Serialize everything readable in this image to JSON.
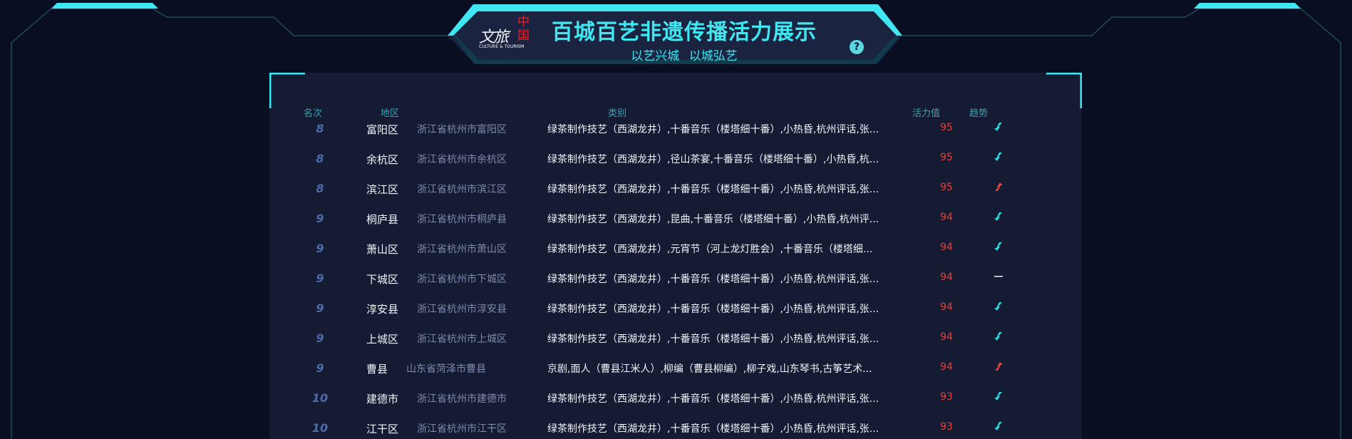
{
  "header": {
    "title": "百城百艺非遗传播活力展示",
    "subtitle": "以艺兴城   以城弘艺",
    "help_label": "?"
  },
  "logo": {
    "text_cn": "文旅",
    "text_zhongguo": "中国",
    "text_en": "CULTURE & TOURISM"
  },
  "colors": {
    "accent": "#41e7f0",
    "background": "#0a0e22",
    "panel": "#141b33",
    "value_red": "#e8413a",
    "rank_blue": "#4e6aa8",
    "trend_up": "#e8413a",
    "trend_down": "#2fd6dd"
  },
  "table": {
    "columns": {
      "rank": "名次",
      "region": "地区",
      "category": "类别",
      "value": "活力值",
      "trend": "趋势"
    },
    "rows": [
      {
        "rank": "8",
        "name": "富阳区",
        "area": "浙江省杭州市富阳区",
        "category": "绿茶制作技艺（西湖龙井）,十番音乐（楼塔细十番）,小热昏,杭州评话,张...",
        "value": "95",
        "trend": "down"
      },
      {
        "rank": "8",
        "name": "余杭区",
        "area": "浙江省杭州市余杭区",
        "category": "绿茶制作技艺（西湖龙井）,径山茶宴,十番音乐（楼塔细十番）,小热昏,杭...",
        "value": "95",
        "trend": "down"
      },
      {
        "rank": "8",
        "name": "滨江区",
        "area": "浙江省杭州市滨江区",
        "category": "绿茶制作技艺（西湖龙井）,十番音乐（楼塔细十番）,小热昏,杭州评话,张...",
        "value": "95",
        "trend": "up"
      },
      {
        "rank": "9",
        "name": "桐庐县",
        "area": "浙江省杭州市桐庐县",
        "category": "绿茶制作技艺（西湖龙井）,昆曲,十番音乐（楼塔细十番）,小热昏,杭州评...",
        "value": "94",
        "trend": "down"
      },
      {
        "rank": "9",
        "name": "萧山区",
        "area": "浙江省杭州市萧山区",
        "category": "绿茶制作技艺（西湖龙井）,元宵节（河上龙灯胜会）,十番音乐（楼塔细...",
        "value": "94",
        "trend": "down"
      },
      {
        "rank": "9",
        "name": "下城区",
        "area": "浙江省杭州市下城区",
        "category": "绿茶制作技艺（西湖龙井）,十番音乐（楼塔细十番）,小热昏,杭州评话,张...",
        "value": "94",
        "trend": "flat"
      },
      {
        "rank": "9",
        "name": "淳安县",
        "area": "浙江省杭州市淳安县",
        "category": "绿茶制作技艺（西湖龙井）,十番音乐（楼塔细十番）,小热昏,杭州评话,张...",
        "value": "94",
        "trend": "down"
      },
      {
        "rank": "9",
        "name": "上城区",
        "area": "浙江省杭州市上城区",
        "category": "绿茶制作技艺（西湖龙井）,十番音乐（楼塔细十番）,小热昏,杭州评话,张...",
        "value": "94",
        "trend": "down"
      },
      {
        "rank": "9",
        "name": "曹县",
        "area": "山东省菏泽市曹县",
        "category": "京剧,面人（曹县江米人）,柳编（曹县柳编）,柳子戏,山东琴书,古筝艺术...",
        "value": "94",
        "trend": "up"
      },
      {
        "rank": "10",
        "name": "建德市",
        "area": "浙江省杭州市建德市",
        "category": "绿茶制作技艺（西湖龙井）,十番音乐（楼塔细十番）,小热昏,杭州评话,张...",
        "value": "93",
        "trend": "down"
      },
      {
        "rank": "10",
        "name": "江干区",
        "area": "浙江省杭州市江干区",
        "category": "绿茶制作技艺（西湖龙井）,十番音乐（楼塔细十番）,小热昏,杭州评话,张...",
        "value": "93",
        "trend": "down"
      }
    ]
  }
}
